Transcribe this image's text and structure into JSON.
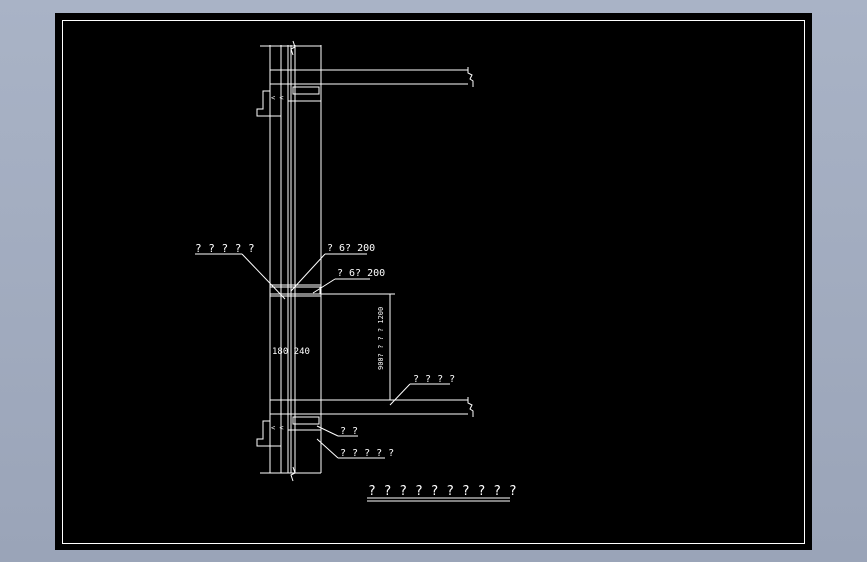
{
  "colors": {
    "background_outer": "#a9b3c6",
    "drawing_bg": "#000000",
    "line": "#ffffff"
  },
  "labels": {
    "left_callout": "? ? ? ? ?",
    "rebar_upper": "? 6? 200",
    "rebar_lower": "? 6? 200",
    "wall_dim": "180  240",
    "height_dim": "900? ? ? ? 1200",
    "slab_label": "? ? ? ?",
    "beam_label": "? ?",
    "wall_label": "? ? ? ? ?",
    "drawing_title": "? ? ? ? ? ? ? ? ? ?",
    "symbol_top": "< <",
    "symbol_bottom": "< <"
  }
}
